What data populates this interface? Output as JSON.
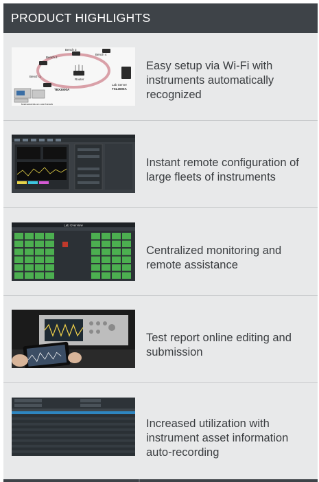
{
  "header": {
    "title": "PRODUCT HIGHLIGHTS"
  },
  "highlights": [
    {
      "text": "Easy setup via Wi-Fi with instruments automatically recognized",
      "image": "network-diagram-image"
    },
    {
      "text": "Instant remote configuration of large fleets of instruments",
      "image": "remote-config-screenshot"
    },
    {
      "text": "Centralized monitoring and remote assistance",
      "image": "lab-overview-screenshot"
    },
    {
      "text": "Test report online editing and submission",
      "image": "oscilloscope-tablet-photo"
    },
    {
      "text": "Increased utilization with instrument asset information auto-recording",
      "image": "asset-table-screenshot"
    }
  ],
  "diagram": {
    "bench_labels": [
      "Bench 1",
      "Bench 2",
      "Bench 3",
      "Bench 4"
    ],
    "router_label": "Router",
    "server_label": "Lab Server",
    "device_labels": [
      "TBX3000A",
      "TSL3000A"
    ],
    "caption": "Instruments on one bench"
  },
  "lab_overview_title": "Lab Overview",
  "colors": {
    "header_bg": "#3e4348",
    "panel_bg": "#e8e9ea",
    "text": "#3a3d40",
    "tile_green": "#4caf50"
  }
}
